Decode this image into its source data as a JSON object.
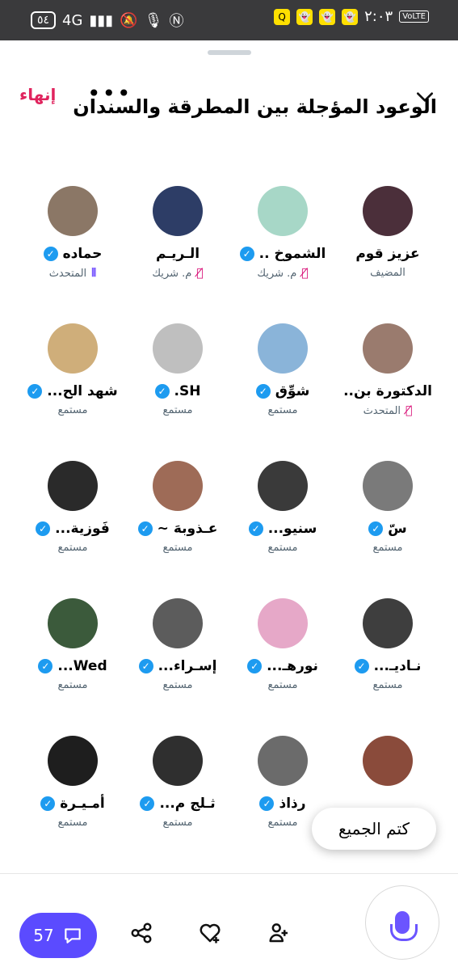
{
  "status_bar": {
    "battery": "٥٤",
    "network": "4G",
    "time": "٢:٠٣",
    "volte": "VoLTE"
  },
  "header": {
    "end_label": "إنهاء",
    "more_label": "•••",
    "title": "الوعود المؤجلة بين المطرقة والسندان"
  },
  "participants": [
    {
      "name": "عزيز قوم",
      "role": "المضيف",
      "verified": false,
      "mic": "none",
      "avatar_color": "#4b2f3a"
    },
    {
      "name": "الشموخ ..",
      "role": "م. شريك",
      "verified": true,
      "mic": "muted",
      "avatar_color": "#a7d7c7"
    },
    {
      "name": "الـريـم",
      "role": "م. شريك",
      "verified": false,
      "mic": "muted",
      "avatar_color": "#2d3d66"
    },
    {
      "name": "حماده",
      "role": "المتحدث",
      "verified": true,
      "mic": "speaking",
      "avatar_color": "#8b7766"
    },
    {
      "name": "الدكتورة بن..",
      "role": "المتحدث",
      "verified": false,
      "mic": "muted",
      "avatar_color": "#9a7b6e"
    },
    {
      "name": "شوِّق",
      "role": "مستمع",
      "verified": true,
      "mic": "none",
      "avatar_color": "#8ab4d9"
    },
    {
      "name": "SH.",
      "role": "مستمع",
      "verified": true,
      "mic": "none",
      "avatar_color": "#bfbfbf"
    },
    {
      "name": "شهد الح...",
      "role": "مستمع",
      "verified": true,
      "mic": "none",
      "avatar_color": "#cfae7a"
    },
    {
      "name": "سّ",
      "role": "مستمع",
      "verified": true,
      "mic": "none",
      "avatar_color": "#7a7a7a"
    },
    {
      "name": "سنيو...",
      "role": "مستمع",
      "verified": true,
      "mic": "none",
      "avatar_color": "#3a3a3a"
    },
    {
      "name": "عـذوبهَ ~",
      "role": "مستمع",
      "verified": true,
      "mic": "none",
      "avatar_color": "#9e6b57"
    },
    {
      "name": "فَوزية...",
      "role": "مستمع",
      "verified": true,
      "mic": "none",
      "avatar_color": "#2a2a2a"
    },
    {
      "name": "نـاديـ...",
      "role": "مستمع",
      "verified": true,
      "mic": "none",
      "avatar_color": "#3e3e3e"
    },
    {
      "name": "نورهـ...",
      "role": "مستمع",
      "verified": true,
      "mic": "none",
      "avatar_color": "#e6a8c8"
    },
    {
      "name": "إسـراء...",
      "role": "مستمع",
      "verified": true,
      "mic": "none",
      "avatar_color": "#5c5c5c"
    },
    {
      "name": "Wed...",
      "role": "مستمع",
      "verified": true,
      "mic": "none",
      "avatar_color": "#3b5a3b"
    },
    {
      "name": "",
      "role": "",
      "verified": false,
      "mic": "none",
      "avatar_color": "#8a4b3b"
    },
    {
      "name": "رذاذ",
      "role": "مستمع",
      "verified": true,
      "mic": "none",
      "avatar_color": "#6b6b6b"
    },
    {
      "name": "ثـلج م...",
      "role": "مستمع",
      "verified": true,
      "mic": "none",
      "avatar_color": "#2f2f2f"
    },
    {
      "name": "أمـيـرة",
      "role": "مستمع",
      "verified": true,
      "mic": "none",
      "avatar_color": "#1e1e1e"
    }
  ],
  "mute_all_label": "كتم الجميع",
  "bottom": {
    "comments_count": "57"
  },
  "colors": {
    "accent": "#5b4bff",
    "danger": "#e0245e",
    "verified": "#1d9bf0"
  }
}
